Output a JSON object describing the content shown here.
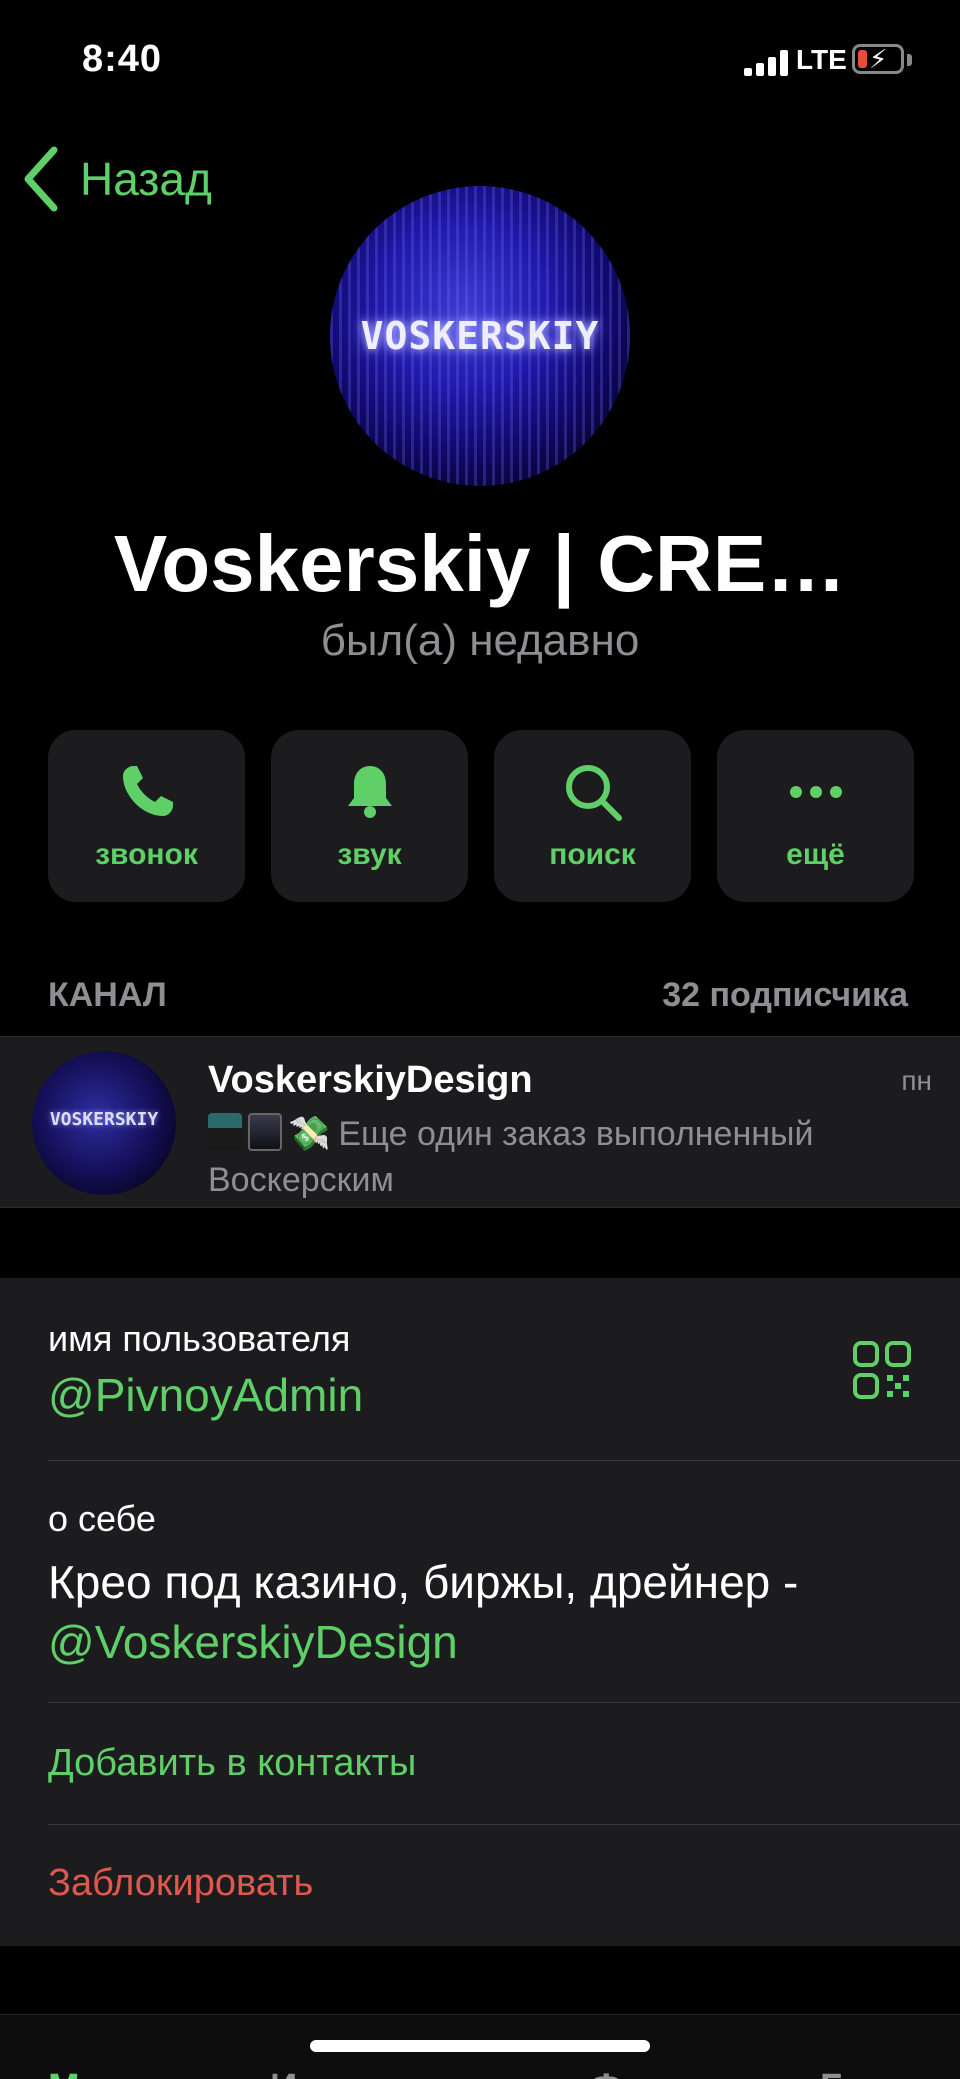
{
  "status_bar": {
    "time": "8:40",
    "network": "LTE"
  },
  "nav": {
    "back_label": "Назад"
  },
  "profile": {
    "avatar_text": "VOSKERSKIY",
    "name": "Voskerskiy | CRE…",
    "status": "был(а) недавно"
  },
  "actions": [
    {
      "label": "звонок",
      "icon": "phone-icon"
    },
    {
      "label": "звук",
      "icon": "bell-icon"
    },
    {
      "label": "поиск",
      "icon": "search-icon"
    },
    {
      "label": "ещё",
      "icon": "more-icon"
    }
  ],
  "channel_section": {
    "title": "КАНАЛ",
    "subscribers": "32 подписчика",
    "channel": {
      "avatar_text": "VOSKERSKIY",
      "name": "VoskerskiyDesign",
      "time": "пн",
      "preview": "Еще один заказ выполненный Воскерским"
    }
  },
  "info": {
    "username_label": "имя пользователя",
    "username": "@PivnoyAdmin",
    "about_label": "о себе",
    "about_text": "Крео под казино, биржы, дрейнер -",
    "about_link": "@VoskerskiyDesign",
    "add_contact": "Добавить в контакты",
    "block": "Заблокировать"
  },
  "tab_bar": {
    "tabs": [
      "М",
      "И",
      "Ф",
      "Г"
    ]
  },
  "colors": {
    "accent": "#5fd068",
    "danger": "#e0584c",
    "card": "#1c1c1e",
    "muted": "#8e8e93"
  }
}
